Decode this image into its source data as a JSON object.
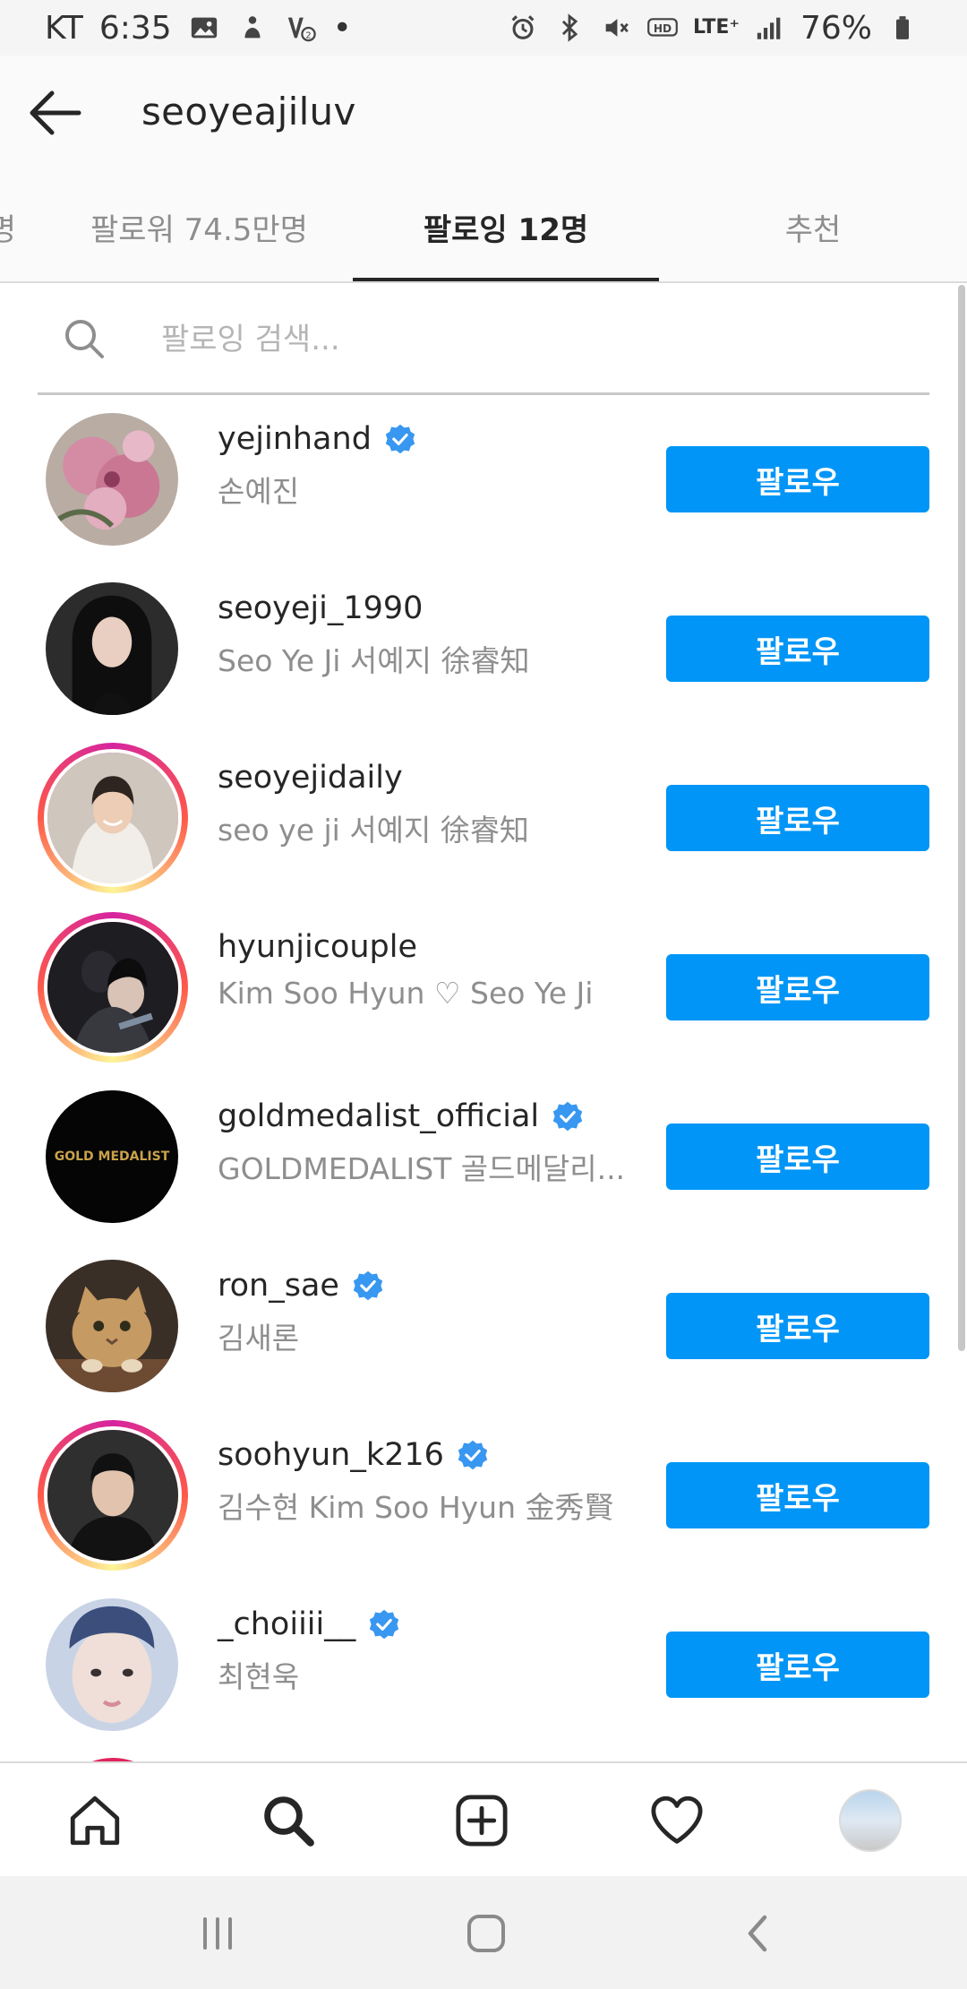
{
  "status_bar": {
    "carrier": "KT",
    "time": "6:35",
    "dot": "•",
    "lte": "LTE⁺",
    "battery_percent": "76%"
  },
  "header": {
    "username": "seoyeajiluv"
  },
  "tabs": [
    {
      "label": "명",
      "active": false
    },
    {
      "label": "팔로워 74.5만명",
      "active": false
    },
    {
      "label": "팔로잉 12명",
      "active": true
    },
    {
      "label": "추천",
      "active": false
    }
  ],
  "search": {
    "placeholder": "팔로잉 검색..."
  },
  "follow_label": "팔로우",
  "users": [
    {
      "username": "yejinhand",
      "full_name": "손예진",
      "verified": true,
      "story_ring": false,
      "avatar": "peony-flowers"
    },
    {
      "username": "seoyeji_1990",
      "full_name": "Seo Ye Ji 서예지 徐睿知",
      "verified": false,
      "story_ring": false,
      "avatar": "woman-dark-hair"
    },
    {
      "username": "seoyejidaily",
      "full_name": "seo ye ji 서예지 徐睿知",
      "verified": false,
      "story_ring": true,
      "avatar": "smiling-woman"
    },
    {
      "username": "hyunjicouple",
      "full_name": "Kim Soo Hyun ♡ Seo Ye Ji",
      "verified": false,
      "story_ring": true,
      "avatar": "couple-embrace"
    },
    {
      "username": "goldmedalist_official",
      "full_name": "GOLDMEDALIST 골드메달리...",
      "verified": true,
      "story_ring": false,
      "avatar": "goldmedalist-logo",
      "logo_text": "GOLD MEDALIST"
    },
    {
      "username": "ron_sae",
      "full_name": "김새론",
      "verified": true,
      "story_ring": false,
      "avatar": "cat"
    },
    {
      "username": "soohyun_k216",
      "full_name": "김수현 Kim Soo Hyun 金秀賢",
      "verified": true,
      "story_ring": true,
      "avatar": "man-portrait"
    },
    {
      "username": "_choiiii__",
      "full_name": "최현욱",
      "verified": true,
      "story_ring": false,
      "avatar": "young-man"
    }
  ],
  "colors": {
    "accent": "#0095f6",
    "verified": "#3897f0",
    "secondary_text": "#8e8e8e"
  },
  "bottom_nav": [
    "home-icon",
    "search-icon",
    "add-icon",
    "heart-icon",
    "profile-avatar"
  ],
  "system_nav": [
    "recent-apps-icon",
    "home-button-icon",
    "back-icon"
  ]
}
